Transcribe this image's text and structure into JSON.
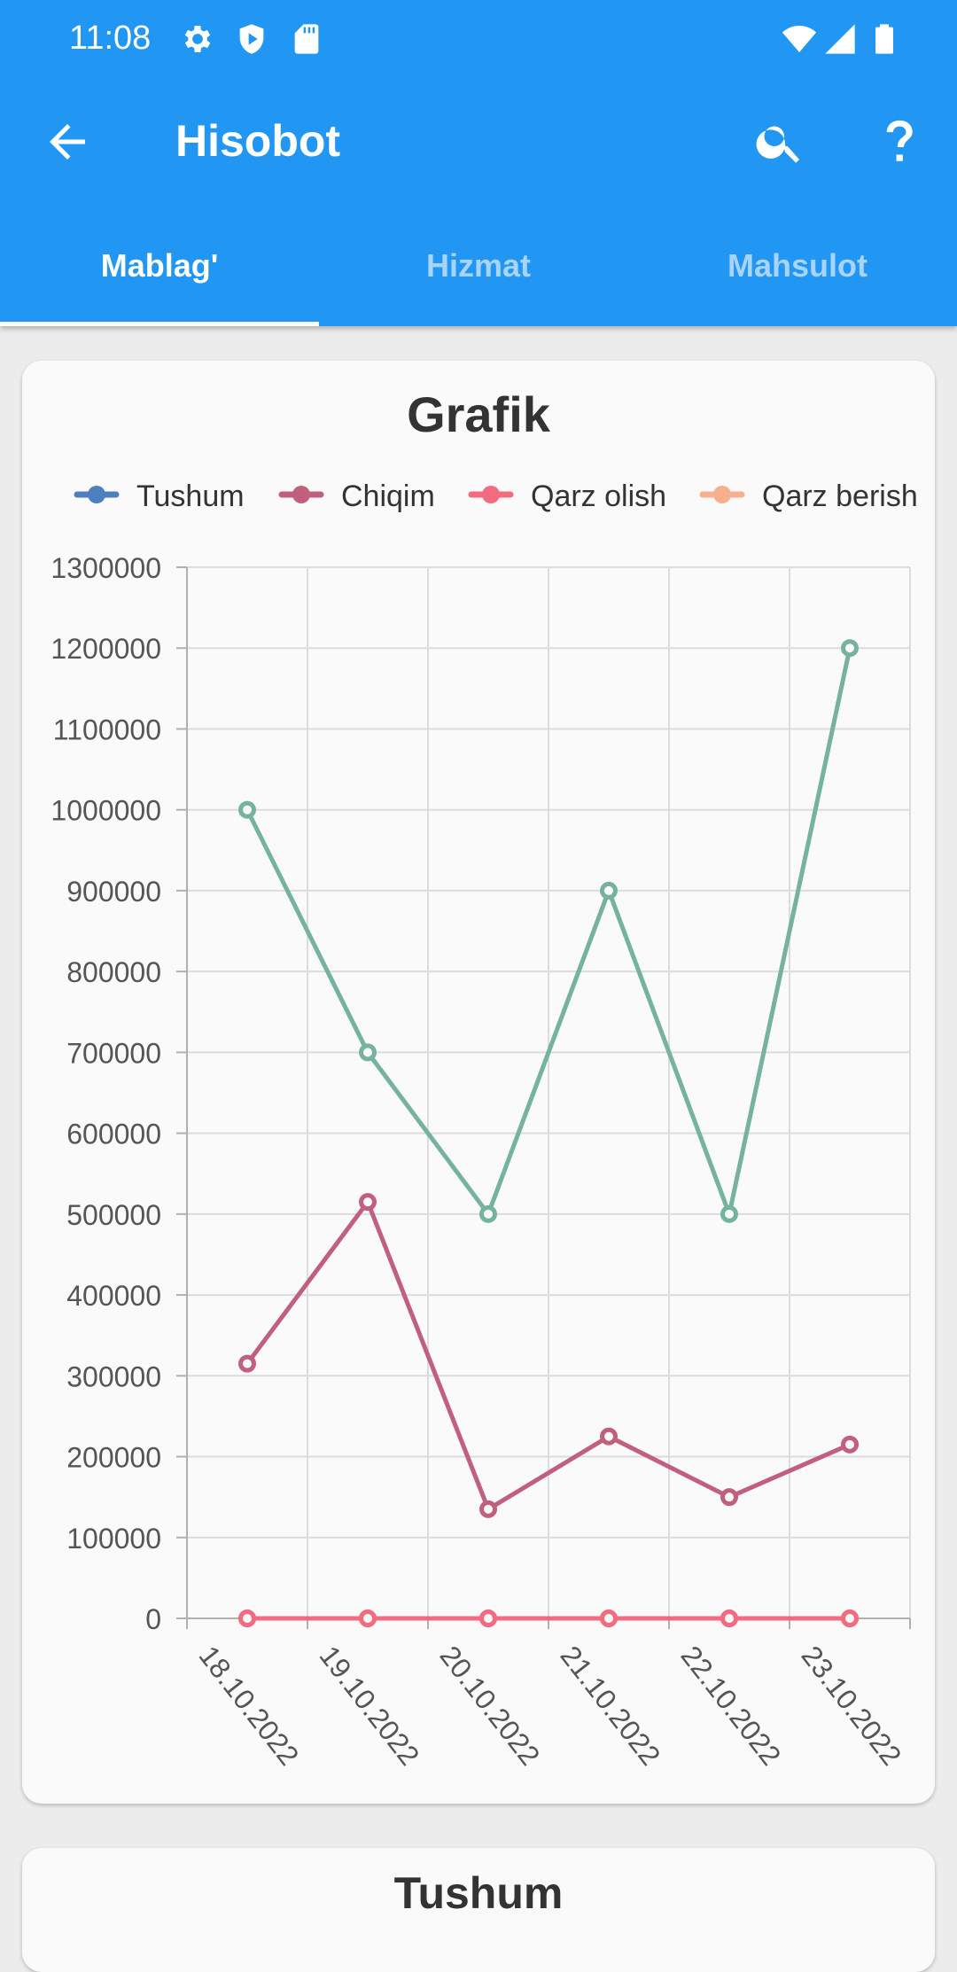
{
  "status_bar": {
    "time": "11:08",
    "icons": [
      "gear-icon",
      "shield-play-icon",
      "sd-card-icon",
      "wifi-icon",
      "signal-icon",
      "battery-icon"
    ]
  },
  "toolbar": {
    "title": "Hisobot",
    "back_icon": "arrow-left-icon",
    "search_icon": "search-icon",
    "help_icon": "help-icon"
  },
  "tabs": [
    {
      "label": "Mablag'",
      "active": true
    },
    {
      "label": "Hizmat",
      "active": false
    },
    {
      "label": "Mahsulot",
      "active": false
    }
  ],
  "colors": {
    "primary": "#2196f3",
    "tab_inactive": "#a8d4fa",
    "legend_tushum": "#4e7fbf",
    "legend_chiqim": "#c0607d",
    "legend_qarz_olish": "#f26b80",
    "legend_qarz_berish": "#f7b08e",
    "line_green": "#76b39c"
  },
  "chart_data": {
    "type": "line",
    "title": "Grafik",
    "categories": [
      "18.10.2022",
      "19.10.2022",
      "20.10.2022",
      "21.10.2022",
      "22.10.2022",
      "23.10.2022"
    ],
    "legend": [
      "Tushum",
      "Chiqim",
      "Qarz olish",
      "Qarz berish"
    ],
    "legend_placement": "top",
    "ylim": [
      0,
      1300000
    ],
    "yticks": [
      0,
      100000,
      200000,
      300000,
      400000,
      500000,
      600000,
      700000,
      800000,
      900000,
      1000000,
      1100000,
      1200000,
      1300000
    ],
    "grid": true,
    "series": [
      {
        "values": [
          1000000,
          700000,
          500000,
          900000,
          500000,
          1200000
        ],
        "color": "#76b39c"
      },
      {
        "values": [
          315000,
          515000,
          135000,
          225000,
          150000,
          215000
        ],
        "color": "#c0607d"
      },
      {
        "values": [
          0,
          0,
          0,
          0,
          0,
          0
        ],
        "color": "#f26b80"
      },
      {
        "values": [
          0,
          0,
          0,
          0,
          0,
          0
        ],
        "color": "#f7b08e"
      }
    ]
  },
  "next_card": {
    "title": "Tushum"
  }
}
